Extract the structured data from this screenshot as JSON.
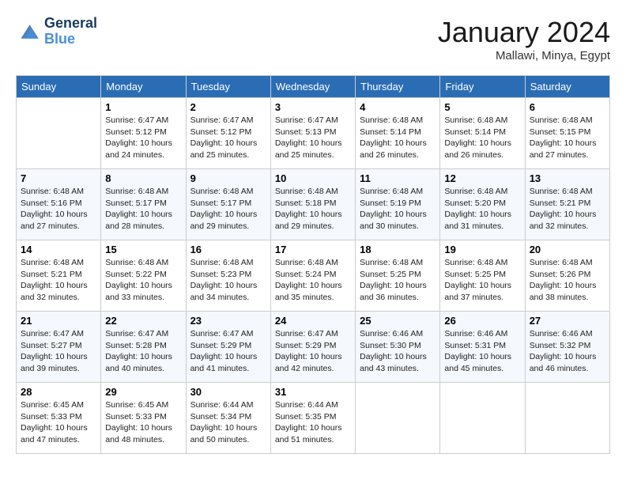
{
  "header": {
    "logo_line1": "General",
    "logo_line2": "Blue",
    "month_title": "January 2024",
    "location": "Mallawi, Minya, Egypt"
  },
  "days_of_week": [
    "Sunday",
    "Monday",
    "Tuesday",
    "Wednesday",
    "Thursday",
    "Friday",
    "Saturday"
  ],
  "weeks": [
    [
      {
        "day": "",
        "sunrise": "",
        "sunset": "",
        "daylight": ""
      },
      {
        "day": "1",
        "sunrise": "Sunrise: 6:47 AM",
        "sunset": "Sunset: 5:12 PM",
        "daylight": "Daylight: 10 hours and 24 minutes."
      },
      {
        "day": "2",
        "sunrise": "Sunrise: 6:47 AM",
        "sunset": "Sunset: 5:12 PM",
        "daylight": "Daylight: 10 hours and 25 minutes."
      },
      {
        "day": "3",
        "sunrise": "Sunrise: 6:47 AM",
        "sunset": "Sunset: 5:13 PM",
        "daylight": "Daylight: 10 hours and 25 minutes."
      },
      {
        "day": "4",
        "sunrise": "Sunrise: 6:48 AM",
        "sunset": "Sunset: 5:14 PM",
        "daylight": "Daylight: 10 hours and 26 minutes."
      },
      {
        "day": "5",
        "sunrise": "Sunrise: 6:48 AM",
        "sunset": "Sunset: 5:14 PM",
        "daylight": "Daylight: 10 hours and 26 minutes."
      },
      {
        "day": "6",
        "sunrise": "Sunrise: 6:48 AM",
        "sunset": "Sunset: 5:15 PM",
        "daylight": "Daylight: 10 hours and 27 minutes."
      }
    ],
    [
      {
        "day": "7",
        "sunrise": "",
        "sunset": "",
        "daylight": ""
      },
      {
        "day": "8",
        "sunrise": "Sunrise: 6:48 AM",
        "sunset": "Sunset: 5:17 PM",
        "daylight": "Daylight: 10 hours and 28 minutes."
      },
      {
        "day": "9",
        "sunrise": "Sunrise: 6:48 AM",
        "sunset": "Sunset: 5:17 PM",
        "daylight": "Daylight: 10 hours and 29 minutes."
      },
      {
        "day": "10",
        "sunrise": "Sunrise: 6:48 AM",
        "sunset": "Sunset: 5:18 PM",
        "daylight": "Daylight: 10 hours and 29 minutes."
      },
      {
        "day": "11",
        "sunrise": "Sunrise: 6:48 AM",
        "sunset": "Sunset: 5:19 PM",
        "daylight": "Daylight: 10 hours and 30 minutes."
      },
      {
        "day": "12",
        "sunrise": "Sunrise: 6:48 AM",
        "sunset": "Sunset: 5:20 PM",
        "daylight": "Daylight: 10 hours and 31 minutes."
      },
      {
        "day": "13",
        "sunrise": "Sunrise: 6:48 AM",
        "sunset": "Sunset: 5:21 PM",
        "daylight": "Daylight: 10 hours and 32 minutes."
      }
    ],
    [
      {
        "day": "14",
        "sunrise": "",
        "sunset": "",
        "daylight": ""
      },
      {
        "day": "15",
        "sunrise": "Sunrise: 6:48 AM",
        "sunset": "Sunset: 5:22 PM",
        "daylight": "Daylight: 10 hours and 33 minutes."
      },
      {
        "day": "16",
        "sunrise": "Sunrise: 6:48 AM",
        "sunset": "Sunset: 5:23 PM",
        "daylight": "Daylight: 10 hours and 34 minutes."
      },
      {
        "day": "17",
        "sunrise": "Sunrise: 6:48 AM",
        "sunset": "Sunset: 5:24 PM",
        "daylight": "Daylight: 10 hours and 35 minutes."
      },
      {
        "day": "18",
        "sunrise": "Sunrise: 6:48 AM",
        "sunset": "Sunset: 5:25 PM",
        "daylight": "Daylight: 10 hours and 36 minutes."
      },
      {
        "day": "19",
        "sunrise": "Sunrise: 6:48 AM",
        "sunset": "Sunset: 5:25 PM",
        "daylight": "Daylight: 10 hours and 37 minutes."
      },
      {
        "day": "20",
        "sunrise": "Sunrise: 6:48 AM",
        "sunset": "Sunset: 5:26 PM",
        "daylight": "Daylight: 10 hours and 38 minutes."
      }
    ],
    [
      {
        "day": "21",
        "sunrise": "",
        "sunset": "",
        "daylight": ""
      },
      {
        "day": "22",
        "sunrise": "Sunrise: 6:47 AM",
        "sunset": "Sunset: 5:28 PM",
        "daylight": "Daylight: 10 hours and 40 minutes."
      },
      {
        "day": "23",
        "sunrise": "Sunrise: 6:47 AM",
        "sunset": "Sunset: 5:29 PM",
        "daylight": "Daylight: 10 hours and 41 minutes."
      },
      {
        "day": "24",
        "sunrise": "Sunrise: 6:47 AM",
        "sunset": "Sunset: 5:29 PM",
        "daylight": "Daylight: 10 hours and 42 minutes."
      },
      {
        "day": "25",
        "sunrise": "Sunrise: 6:46 AM",
        "sunset": "Sunset: 5:30 PM",
        "daylight": "Daylight: 10 hours and 43 minutes."
      },
      {
        "day": "26",
        "sunrise": "Sunrise: 6:46 AM",
        "sunset": "Sunset: 5:31 PM",
        "daylight": "Daylight: 10 hours and 45 minutes."
      },
      {
        "day": "27",
        "sunrise": "Sunrise: 6:46 AM",
        "sunset": "Sunset: 5:32 PM",
        "daylight": "Daylight: 10 hours and 46 minutes."
      }
    ],
    [
      {
        "day": "28",
        "sunrise": "Sunrise: 6:45 AM",
        "sunset": "Sunset: 5:33 PM",
        "daylight": "Daylight: 10 hours and 47 minutes."
      },
      {
        "day": "29",
        "sunrise": "Sunrise: 6:45 AM",
        "sunset": "Sunset: 5:33 PM",
        "daylight": "Daylight: 10 hours and 48 minutes."
      },
      {
        "day": "30",
        "sunrise": "Sunrise: 6:44 AM",
        "sunset": "Sunset: 5:34 PM",
        "daylight": "Daylight: 10 hours and 50 minutes."
      },
      {
        "day": "31",
        "sunrise": "Sunrise: 6:44 AM",
        "sunset": "Sunset: 5:35 PM",
        "daylight": "Daylight: 10 hours and 51 minutes."
      },
      {
        "day": "",
        "sunrise": "",
        "sunset": "",
        "daylight": ""
      },
      {
        "day": "",
        "sunrise": "",
        "sunset": "",
        "daylight": ""
      },
      {
        "day": "",
        "sunrise": "",
        "sunset": "",
        "daylight": ""
      }
    ]
  ],
  "week1_sun": {
    "sunrise": "Sunrise: 6:48 AM",
    "sunset": "Sunset: 5:16 PM",
    "daylight": "Daylight: 10 hours and 27 minutes."
  },
  "week2_sun": {
    "sunrise": "Sunrise: 6:48 AM",
    "sunset": "Sunset: 5:16 PM",
    "daylight": "Daylight: 10 hours and 27 minutes."
  },
  "week3_sun": {
    "sunrise": "Sunrise: 6:48 AM",
    "sunset": "Sunset: 5:21 PM",
    "daylight": "Daylight: 10 hours and 32 minutes."
  },
  "week4_sun": {
    "sunrise": "Sunrise: 6:47 AM",
    "sunset": "Sunset: 5:27 PM",
    "daylight": "Daylight: 10 hours and 39 minutes."
  }
}
